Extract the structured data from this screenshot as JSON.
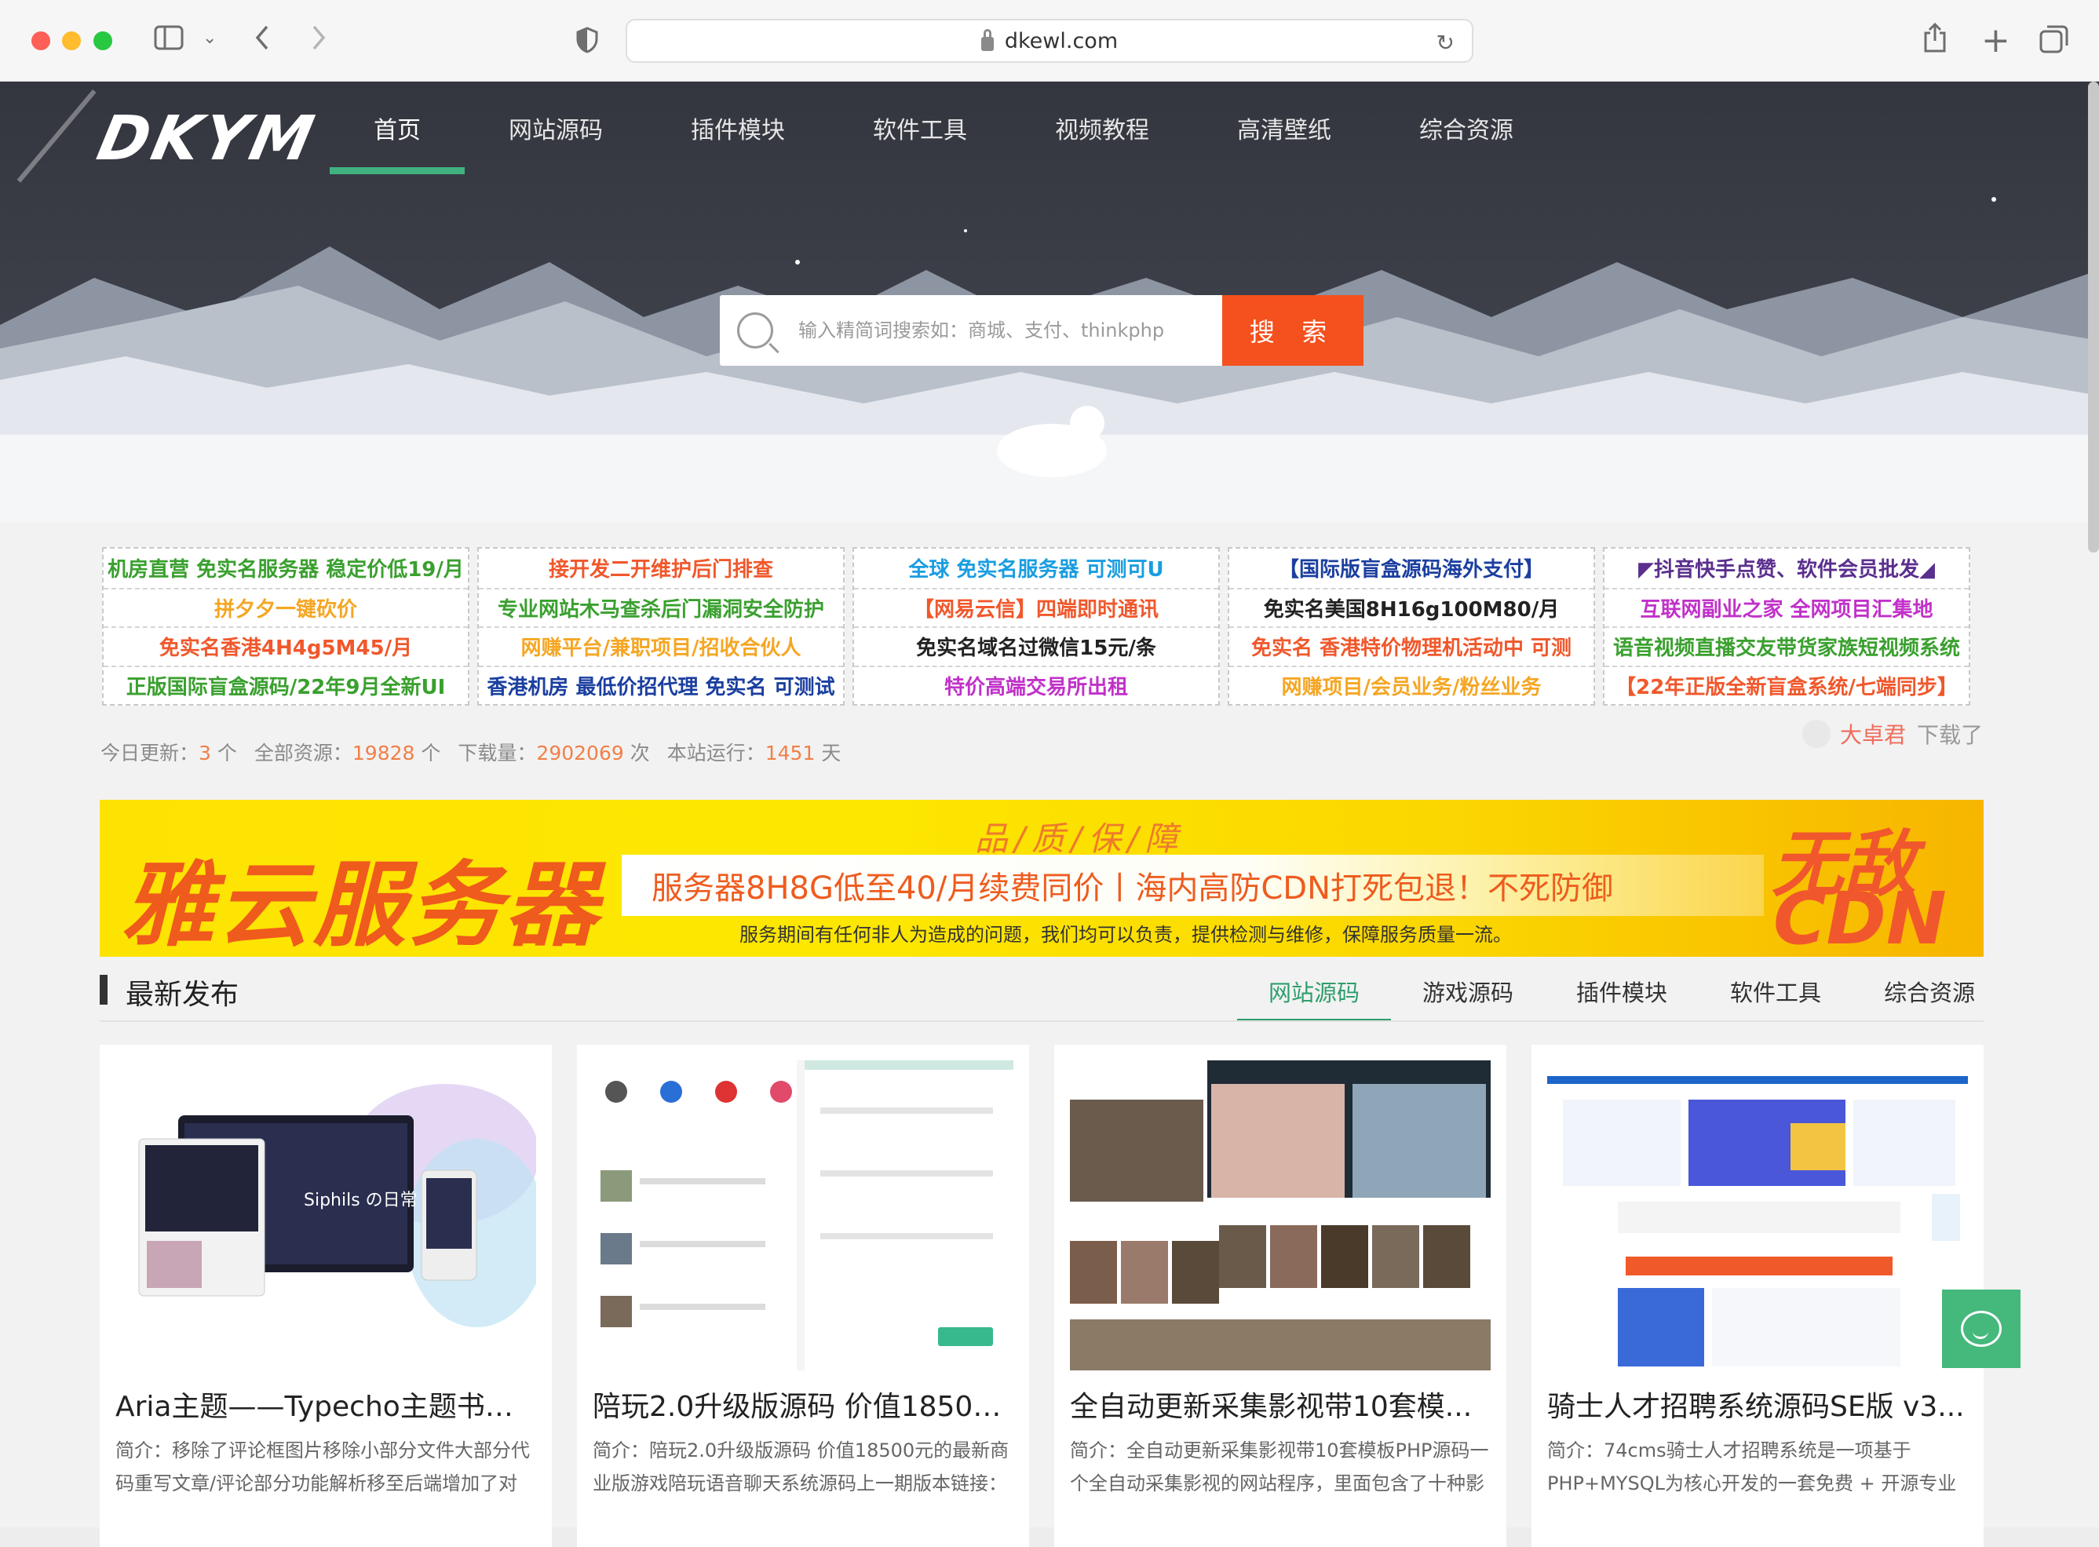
{
  "browser": {
    "url": "dkewl.com"
  },
  "site": {
    "logo": "DKYM",
    "nav": [
      {
        "label": "首页",
        "active": true
      },
      {
        "label": "网站源码",
        "active": false
      },
      {
        "label": "插件模块",
        "active": false
      },
      {
        "label": "软件工具",
        "active": false
      },
      {
        "label": "视频教程",
        "active": false
      },
      {
        "label": "高清壁纸",
        "active": false
      },
      {
        "label": "综合资源",
        "active": false
      }
    ],
    "search": {
      "placeholder": "输入精简词搜索如：商城、支付、thinkphp",
      "button": "搜 索"
    }
  },
  "ads": [
    [
      {
        "text": "机房直营 免实名服务器 稳定价低19/月",
        "color": "#3aa02f"
      },
      {
        "text": "拼夕夕一键砍价",
        "color": "#f5a623"
      },
      {
        "text": "免实名香港4H4g5M45/月",
        "color": "#f0582c"
      },
      {
        "text": "正版国际盲盒源码/22年9月全新UI",
        "color": "#3aa02f"
      }
    ],
    [
      {
        "text": "接开发二开维护后门排查",
        "color": "#f0582c"
      },
      {
        "text": "专业网站木马查杀后门漏洞安全防护",
        "color": "#3aa02f"
      },
      {
        "text": "网赚平台/兼职项目/招收合伙人",
        "color": "#f5a623"
      },
      {
        "text": "香港机房 最低价招代理 免实名 可测试",
        "color": "#1b3fa0"
      }
    ],
    [
      {
        "text": "全球 免实名服务器 可测可U",
        "color": "#1a9de0"
      },
      {
        "text": "【网易云信】四端即时通讯",
        "color": "#f0582c"
      },
      {
        "text": "免实名域名过微信15元/条",
        "color": "#222222"
      },
      {
        "text": "特价高端交易所出租",
        "color": "#c131c9"
      }
    ],
    [
      {
        "text": "【国际版盲盒源码海外支付】",
        "color": "#1b3fa0"
      },
      {
        "text": "免实名美国8H16g100M80/月",
        "color": "#222222"
      },
      {
        "text": "免实名 香港特价物理机活动中 可测",
        "color": "#f0582c"
      },
      {
        "text": "网赚项目/会员业务/粉丝业务",
        "color": "#f5a623"
      }
    ],
    [
      {
        "text": "◤抖音快手点赞、软件会员批发◢",
        "color": "#5b2f8e"
      },
      {
        "text": "互联网副业之家 全网项目汇集地",
        "color": "#c131c9"
      },
      {
        "text": "语音视频直播交友带货家族短视频系统",
        "color": "#3aa02f"
      },
      {
        "text": "【22年正版全新盲盒系统/七端同步】",
        "color": "#f0582c"
      }
    ]
  ],
  "stats": {
    "today_label": "今日更新：",
    "today_value": "3",
    "today_unit": "个",
    "total_label": "全部资源：",
    "total_value": "19828",
    "total_unit": "个",
    "downloads_label": "下载量：",
    "downloads_value": "2902069",
    "downloads_unit": "次",
    "running_label": "本站运行：",
    "running_value": "1451",
    "running_unit": "天"
  },
  "recent_download": {
    "user": "大卓君",
    "action": "下载了"
  },
  "banner": {
    "brand": "雅云服务器",
    "quality": "品/质/保/障",
    "headline": "服务器8H8G低至40/月续费同价丨海内高防CDN打死包退！不死防御",
    "sub": "服务期间有任何非人为造成的问题，我们均可以负责，提供检测与维修，保障服务质量一流。",
    "right_top": "无敌",
    "right_bottom": "CDN"
  },
  "latest": {
    "title": "最新发布",
    "tabs": [
      {
        "label": "网站源码",
        "active": true
      },
      {
        "label": "游戏源码",
        "active": false
      },
      {
        "label": "插件模块",
        "active": false
      },
      {
        "label": "软件工具",
        "active": false
      },
      {
        "label": "综合资源",
        "active": false
      }
    ],
    "cards": [
      {
        "title": "Aria主题——Typecho主题书写...",
        "desc": "简介：移除了评论框图片移除小部分文件大部分代码重写文章/评论部分功能解析移至后端增加了对",
        "thumb_text": "Siphils の日常"
      },
      {
        "title": "陪玩2.0升级版源码 价值18500...",
        "desc": "简介：陪玩2.0升级版源码 价值18500元的最新商业版游戏陪玩语音聊天系统源码上一期版本链接：",
        "thumb_text": ""
      },
      {
        "title": "全自动更新采集影视带10套模...",
        "desc": "简介：全自动更新采集影视带10套模板PHP源码一个全自动采集影视的网站程序，里面包含了十种影",
        "thumb_text": ""
      },
      {
        "title": "骑士人才招聘系统源码SE版 v3...",
        "desc": "简介：74cms骑士人才招聘系统是一项基于PHP+MYSQL为核心开发的一套免费 + 开源专业",
        "thumb_text": ""
      }
    ]
  }
}
